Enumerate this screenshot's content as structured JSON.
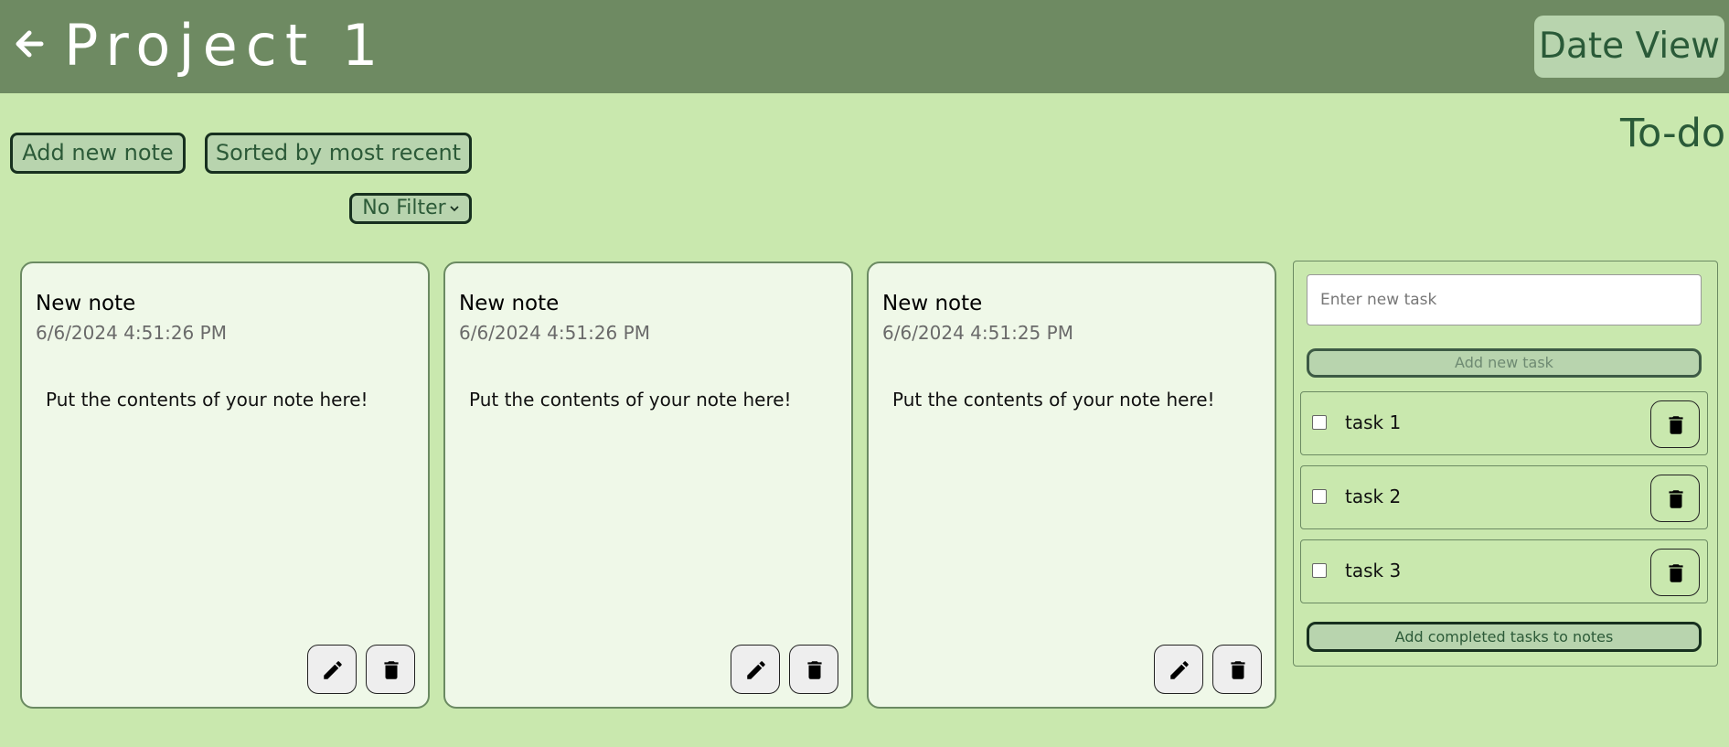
{
  "header": {
    "title": "Project 1",
    "back_icon": "arrow-left-icon",
    "date_view_label": "Date View"
  },
  "toolbar": {
    "add_note_label": "Add new note",
    "sort_label": "Sorted by most recent",
    "filter_label": "No Filter",
    "filter_icon": "chevron-down-icon"
  },
  "notes": [
    {
      "title": "New note",
      "date": "6/6/2024  4:51:26 PM",
      "body": "Put the contents of your note here!"
    },
    {
      "title": "New note",
      "date": "6/6/2024  4:51:26 PM",
      "body": "Put the contents of your note here!"
    },
    {
      "title": "New note",
      "date": "6/6/2024  4:51:25 PM",
      "body": "Put the contents of your note here!"
    }
  ],
  "todo": {
    "heading": "To-do",
    "input_placeholder": "Enter new task",
    "add_task_label": "Add new task",
    "tasks": [
      {
        "label": "task 1",
        "checked": false
      },
      {
        "label": "task 2",
        "checked": false
      },
      {
        "label": "task 3",
        "checked": false
      }
    ],
    "add_completed_label": "Add completed tasks to notes"
  },
  "icons": {
    "edit": "pencil-icon",
    "delete": "trash-icon"
  },
  "colors": {
    "background": "#c9e8ae",
    "header": "#6e8a62",
    "card": "#eff8e8",
    "button": "#b8d4ae",
    "accent_text": "#2a5a38"
  }
}
